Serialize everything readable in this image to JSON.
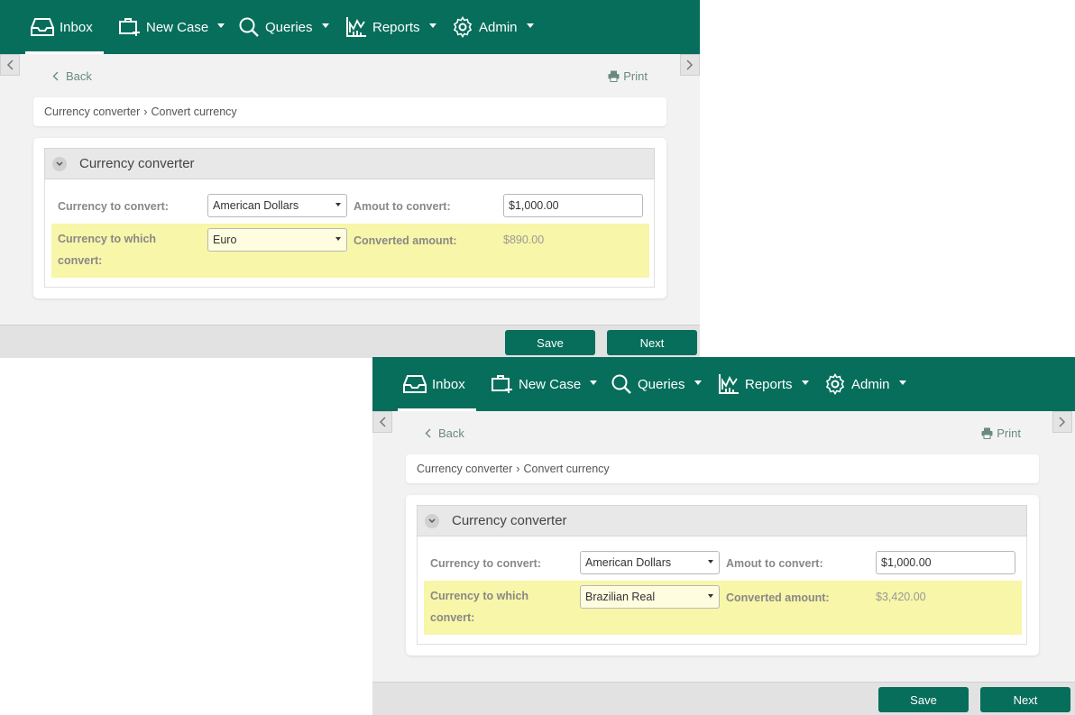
{
  "nav": {
    "inbox": "Inbox",
    "new_case": "New Case",
    "queries": "Queries",
    "reports": "Reports",
    "admin": "Admin"
  },
  "page": {
    "back": "Back",
    "print": "Print",
    "breadcrumb": [
      "Currency converter",
      "Convert currency"
    ],
    "breadcrumb_separator": "›",
    "section_title": "Currency converter"
  },
  "labels": {
    "currency_to_convert": "Currency to convert:",
    "amount_to_convert": "Amout to convert:",
    "currency_to_which_convert_line1": "Currency to which",
    "currency_to_which_convert_line2": "convert:",
    "converted_amount": "Converted amount:"
  },
  "buttons": {
    "save": "Save",
    "next": "Next"
  },
  "screens": [
    {
      "currency_to_convert": "American Dollars",
      "amount_to_convert": "$1,000.00",
      "target_currency": "Euro",
      "converted_amount": "$890.00"
    },
    {
      "currency_to_convert": "American Dollars",
      "amount_to_convert": "$1,000.00",
      "target_currency": "Brazilian Real",
      "converted_amount": "$3,420.00"
    }
  ],
  "colors": {
    "brand_green": "#066e5b",
    "highlight_row": "#f8f6a8"
  }
}
